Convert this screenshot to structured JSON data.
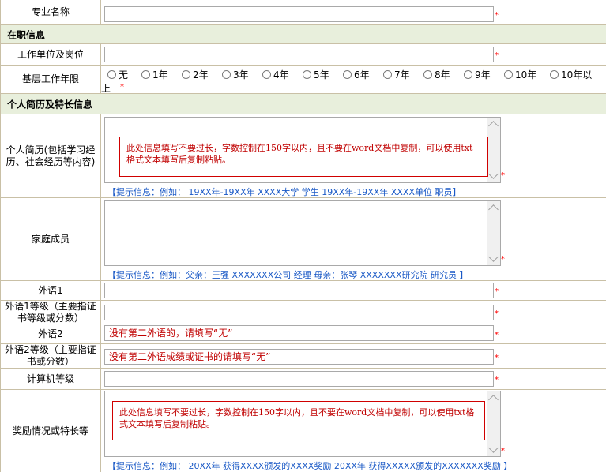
{
  "required_mark": "*",
  "major": {
    "label": "专业名称",
    "value": ""
  },
  "section_job": "在职信息",
  "employer": {
    "label": "工作单位及岗位",
    "value": ""
  },
  "grassroots": {
    "label": "基层工作年限",
    "options": [
      "无",
      "1年",
      "2年",
      "3年",
      "4年",
      "5年",
      "6年",
      "7年",
      "8年",
      "9年",
      "10年",
      "10年以"
    ],
    "wrap_text": "上"
  },
  "section_resume": "个人简历及特长信息",
  "resume": {
    "label": "个人简历(包括学习经历、社会经历等内容)",
    "note": "此处信息填写不要过长，字数控制在150字以内，且不要在word文档中复制，可以使用txt格式文本填写后复制粘贴。",
    "hint": "【提示信息：例如：  19XX年-19XX年  XXXX大学 学生  19XX年-19XX年  XXXX单位 职员】"
  },
  "family": {
    "label": "家庭成员",
    "hint": "【提示信息：例如：父亲：王强  XXXXXXX公司 经理  母亲：张琴  XXXXXXX研究院 研究员 】"
  },
  "lang1": {
    "label": "外语1",
    "value": ""
  },
  "lang1_level": {
    "label": "外语1等级（主要指证书等级或分数）",
    "value": ""
  },
  "lang2": {
    "label": "外语2",
    "value": "没有第二外语的，请填写“无”"
  },
  "lang2_level": {
    "label": "外语2等级（主要指证书或分数）",
    "value": "没有第二外语成绩或证书的请填写“无”"
  },
  "computer": {
    "label": "计算机等级",
    "value": ""
  },
  "awards": {
    "label": "奖励情况或特长等",
    "note": "此处信息填写不要过长，字数控制在150字以内，且不要在word文档中复制，可以使用txt格式文本填写后复制粘贴。",
    "hint": "【提示信息：例如：  20XX年  获得XXXX颁发的XXXX奖励  20XX年  获得XXXXX颁发的XXXXXXX奖励 】"
  }
}
